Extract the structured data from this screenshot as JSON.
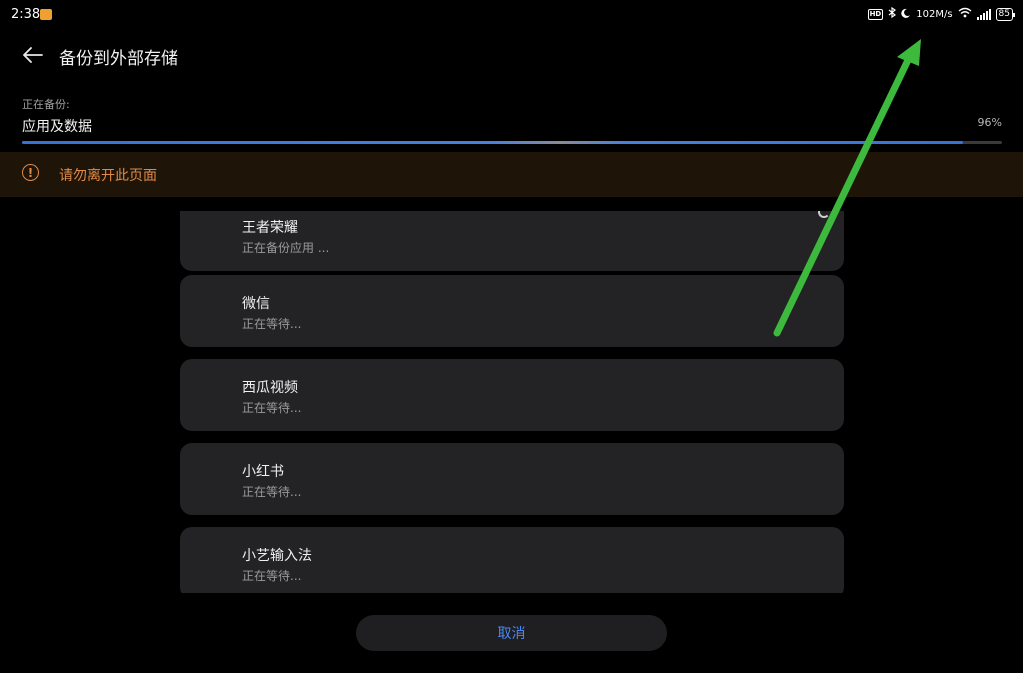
{
  "status_bar": {
    "time": "2:38",
    "net_speed": "102M/s",
    "battery": "85",
    "hd_label": "HD",
    "icons": [
      "notification-app-icon",
      "hd-icon",
      "bluetooth-icon",
      "moon-icon",
      "wifi-icon",
      "signal-icon",
      "battery-icon"
    ]
  },
  "header": {
    "title": "备份到外部存储",
    "back_icon": "back-arrow-icon"
  },
  "progress": {
    "sub_label": "正在备份:",
    "main_label": "应用及数据",
    "percent_text": "96%",
    "value": 0.96,
    "colors": {
      "fill": "#3a6fd8",
      "track": "#3a3a3a"
    }
  },
  "warning": {
    "text": "请勿离开此页面",
    "icon": "warning-icon",
    "color": "#e08a46"
  },
  "apps": [
    {
      "name": "王者荣耀",
      "status": "正在备份应用 ..."
    },
    {
      "name": "微信",
      "status": "正在等待..."
    },
    {
      "name": "西瓜视频",
      "status": "正在等待..."
    },
    {
      "name": "小红书",
      "status": "正在等待..."
    },
    {
      "name": "小艺输入法",
      "status": "正在等待..."
    }
  ],
  "cancel_label": "取消",
  "annotation": {
    "type": "arrow",
    "color": "#3dba3d"
  }
}
